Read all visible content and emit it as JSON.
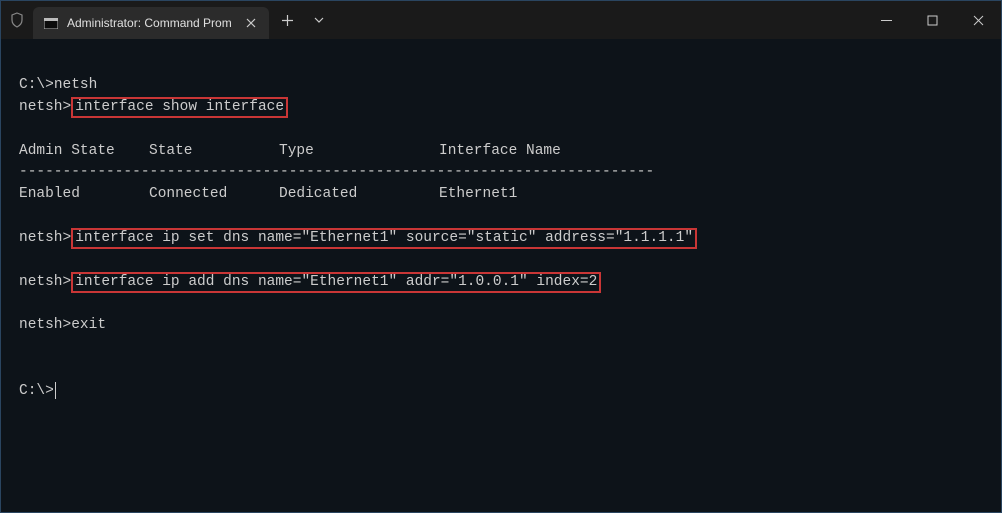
{
  "tab": {
    "title": "Administrator: Command Prom"
  },
  "terminal": {
    "line1_prompt": "C:\\>",
    "line1_cmd": "netsh",
    "line2_prompt": "netsh>",
    "line2_cmd": "interface show interface",
    "header1": "Admin State",
    "header2": "State",
    "header3": "Type",
    "header4": "Interface Name",
    "sep": "-------------------------------------------------------------------------",
    "row_admin": "Enabled",
    "row_state": "Connected",
    "row_type": "Dedicated",
    "row_name": "Ethernet1",
    "line3_prompt": "netsh>",
    "line3_cmd": "interface ip set dns name=\"Ethernet1\" source=\"static\" address=\"1.1.1.1\"",
    "line4_prompt": "netsh>",
    "line4_cmd": "interface ip add dns name=\"Ethernet1\" addr=\"1.0.0.1\" index=2",
    "line5_prompt": "netsh>",
    "line5_cmd": "exit",
    "line6_prompt": "C:\\>"
  }
}
